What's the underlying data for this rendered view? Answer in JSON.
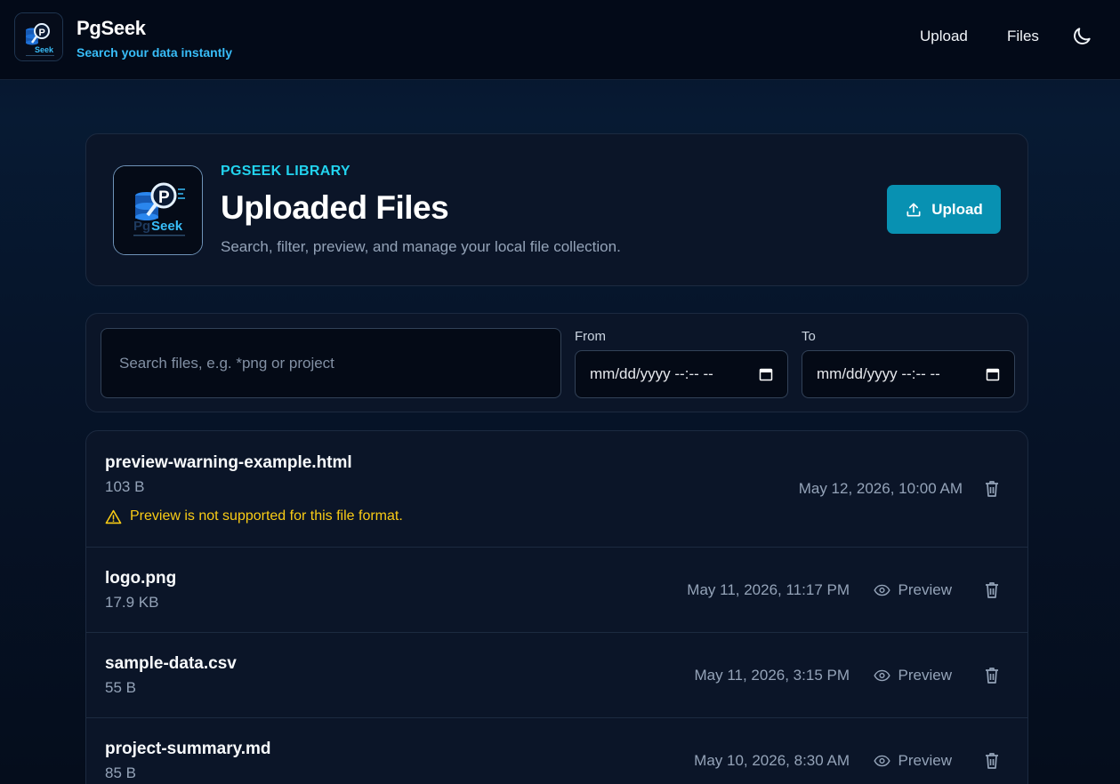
{
  "header": {
    "brand_name": "PgSeek",
    "tagline": "Search your data instantly",
    "nav": {
      "upload_label": "Upload",
      "files_label": "Files"
    },
    "theme_icon": "moon-icon"
  },
  "hero": {
    "eyebrow": "PGSEEK LIBRARY",
    "title": "Uploaded Files",
    "subtitle": "Search, filter, preview, and manage your local file collection.",
    "upload_label": "Upload",
    "upload_icon": "upload-icon",
    "logo_text": "PgSeek",
    "logo_subtext": "SEARCH YOUR DATA INSTANTLY"
  },
  "filters": {
    "search_placeholder": "Search files, e.g. *png or project",
    "search_value": "",
    "from_label": "From",
    "to_label": "To",
    "from_value": "mm/dd/yyyy --:-- --",
    "to_value": "mm/dd/yyyy --:-- --"
  },
  "files": [
    {
      "name": "preview-warning-example.html",
      "size": "103 B",
      "date": "May 12, 2026, 10:00 AM",
      "warning": "Preview is not supported for this file format."
    },
    {
      "name": "logo.png",
      "size": "17.9 KB",
      "date": "May 11, 2026, 11:17 PM",
      "preview_label": "Preview"
    },
    {
      "name": "sample-data.csv",
      "size": "55 B",
      "date": "May 11, 2026, 3:15 PM",
      "preview_label": "Preview"
    },
    {
      "name": "project-summary.md",
      "size": "85 B",
      "date": "May 10, 2026, 8:30 AM",
      "preview_label": "Preview"
    }
  ],
  "colors": {
    "accent": "#22d3ee",
    "button": "#0891b2",
    "warning": "#facc15",
    "card": "#0b1528"
  }
}
